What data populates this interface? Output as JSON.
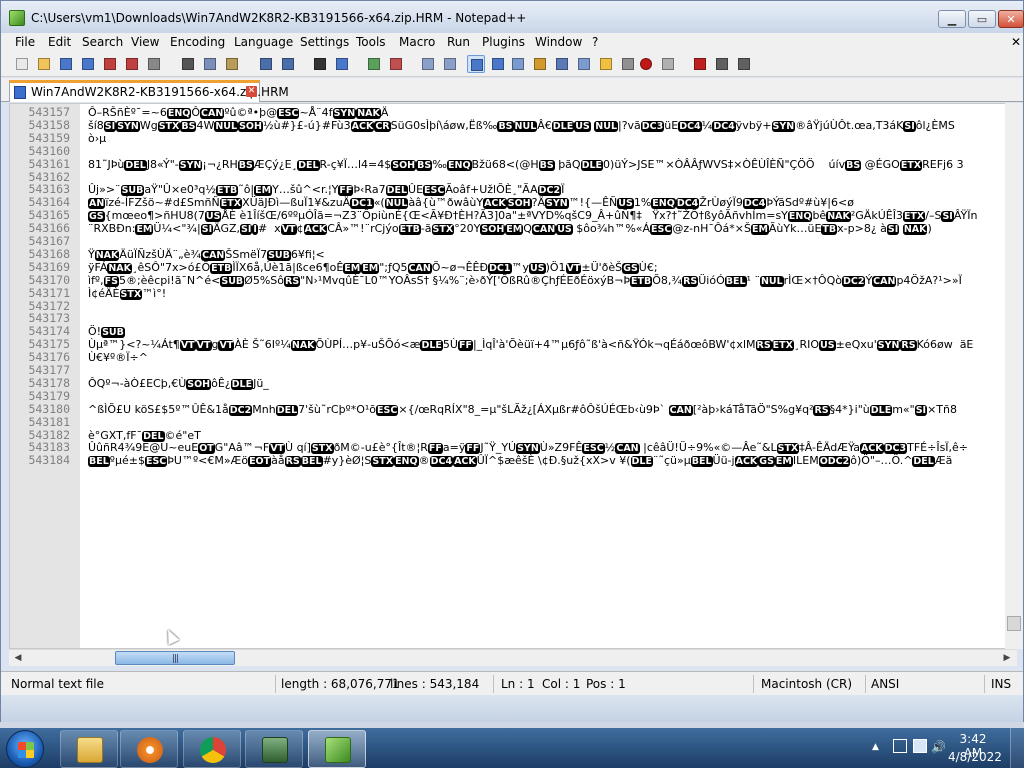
{
  "window": {
    "title": "C:\\Users\\vm1\\Downloads\\Win7AndW2K8R2-KB3191566-x64.zip.HRM - Notepad++",
    "min_glyph": "▁",
    "max_glyph": "▭",
    "close_glyph": "✕"
  },
  "menu": [
    "File",
    "Edit",
    "Search",
    "View",
    "Encoding",
    "Language",
    "Settings",
    "Tools",
    "Macro",
    "Run",
    "Plugins",
    "Window",
    "?"
  ],
  "menu_close": "✕",
  "toolbar_icons": [
    "new-file-icon",
    "open-file-icon",
    "save-icon",
    "save-all-icon",
    "close-icon",
    "close-all-icon",
    "print-icon",
    "cut-icon",
    "copy-icon",
    "paste-icon",
    "undo-icon",
    "redo-icon",
    "find-icon",
    "replace-icon",
    "zoom-in-icon",
    "zoom-out-icon",
    "sync-vertical-icon",
    "sync-horizontal-icon",
    "word-wrap-icon",
    "show-all-chars-icon",
    "indent-guide-icon",
    "user-defined-lang-icon",
    "doc-map-icon",
    "function-list-icon",
    "folder-workspace-icon",
    "monitor-icon",
    "record-macro-icon",
    "stop-record-icon",
    "play-macro-icon",
    "run-macro-multiple-icon",
    "save-macro-icon"
  ],
  "tab": {
    "label": "Win7AndW2K8R2-KB3191566-x64.zip.HRM",
    "close_glyph": "✕"
  },
  "editor": {
    "lines": [
      {
        "n": "543157",
        "t": "Ô–RŠñÈº¯=~6",
        "cc": [
          [
            "ENQ"
          ],
          "Ô",
          [
            "CAN"
          ],
          "ºû©ª•þ@",
          [
            "ESC"
          ],
          "~Å¨4f",
          [
            "SYN"
          ],
          [
            "NAK"
          ],
          "Ä"
        ]
      },
      {
        "n": "543158",
        "t": "ší8",
        "cc": [
          [
            "SI"
          ],
          [
            "SYN"
          ],
          "Wg",
          [
            "STX"
          ],
          [
            "BS"
          ],
          "4W",
          [
            "NUL"
          ],
          [
            "SOH"
          ],
          "½ù#}£-ú}#Fù3",
          [
            "ACK"
          ],
          [
            "CR"
          ],
          "SüG0sÌþí\\áøw,Ëß‰",
          [
            "BS"
          ],
          [
            "NUL"
          ],
          "Â€",
          [
            "DLE"
          ],
          [
            "US"
          ],
          " ",
          [
            "NUL"
          ],
          "|?vã",
          [
            "DC3"
          ],
          "üE",
          [
            "DC4"
          ],
          "¼",
          [
            "DC4"
          ],
          "ÿvbÿ+",
          [
            "SYN"
          ],
          "®âŸjúÙÔt.œa,T3áK",
          [
            "SI"
          ],
          "ôl¿ÈMS"
        ]
      },
      {
        "n": "543159",
        "t": "ò›µ",
        "cc": []
      },
      {
        "n": "543160",
        "t": "",
        "cc": []
      },
      {
        "n": "543161",
        "t": "81˜JÞù",
        "cc": [
          [
            "DEL"
          ],
          "J8«Ý\"-",
          [
            "SYN"
          ],
          "¡¬¿RH",
          [
            "BS"
          ],
          "ÆÇý¿E¸",
          [
            "DEL"
          ],
          "R-ç¥Ï…l4=4$",
          [
            "SOH"
          ],
          [
            "BS"
          ],
          "‰",
          [
            "ENQ"
          ],
          "Bžü68<(@H",
          [
            "BS"
          ],
          " þãQ",
          [
            "DLE"
          ],
          "0)üÝ>JSE™×ÒÂÂƒWVS‡×ÒÊÙÎÈÑ\"ÇÖÖ    úív",
          [
            "BS"
          ],
          " @ÉGO",
          [
            "ETX"
          ],
          "REFj6 3"
        ]
      },
      {
        "n": "543162",
        "t": "",
        "cc": []
      },
      {
        "n": "543163",
        "t": "Ûj»>¨",
        "cc": [
          [
            "SUB"
          ],
          "aŸ\"Û×e0³q½",
          [
            "ETB"
          ],
          "˜ô|",
          [
            "EM"
          ],
          "Y…šû^<r.¦Y",
          [
            "FF"
          ],
          "Þ‹Ra7",
          [
            "DEL"
          ],
          "ÛE",
          [
            "ESC"
          ],
          "Ãoâf+UžlÕÈ¸\"ÃA",
          [
            "DC2"
          ],
          "Ï"
        ]
      },
      {
        "n": "543164",
        "t": "",
        "cc": [
          [
            "AN"
          ],
          "ïzé-ÍFZšö~#d£SmñÑ",
          [
            "ETX"
          ],
          "XÜäJÐì—ßuÏ1¥&zuÄ",
          [
            "DC1"
          ],
          "«(",
          [
            "NUL"
          ],
          "àâ{ù™ðwâùY",
          [
            "ACK"
          ],
          [
            "SOH"
          ],
          "?Ä",
          [
            "SYN"
          ],
          "™!{—ÊÑ",
          [
            "US"
          ],
          "1%",
          [
            "ENQ"
          ],
          [
            "DC4"
          ],
          "ŽrÙøýÏ9",
          [
            "DC4"
          ],
          "ÞÝãSdº#ù¥|6<ø"
        ]
      },
      {
        "n": "543165",
        "t": "",
        "cc": [
          [
            "GS"
          ],
          "{mœeo¶>ñHU8(7",
          [
            "US"
          ],
          "ÅÈ è1ÎíšŒ/6ººµÓÎã=¬Z3¨ÕpiùnÉ{Œ<Ã¥Ð†ÈH?Ã3]0a\"±ªVYD%qšC9_Â+ûÑ¶‡   Ÿx?†˜ŽÕ†ßyôÃñvhÍm=sY",
          [
            "ENQ"
          ],
          "bê",
          [
            "NAK"
          ],
          "²GÄkÚÊÎ3",
          [
            "ETX"
          ],
          "/–S",
          [
            "SI"
          ],
          "ÂŸÏn"
        ]
      },
      {
        "n": "543166",
        "t": "¨RXBÐn:",
        "cc": [
          [
            "EM"
          ],
          "Ü¼<\"¾|",
          [
            "SI"
          ],
          "ÄGZ,",
          [
            "SI"
          ],
          [
            "I"
          ],
          "#  x",
          [
            "VT"
          ],
          "¢",
          [
            "ACK"
          ],
          "CÂ»™!¨rCjýo",
          [
            "ETB"
          ],
          "-ã",
          [
            "STX"
          ],
          "°20Y",
          [
            "SOH"
          ],
          [
            "EM"
          ],
          "Q",
          [
            "CAN"
          ],
          [
            "US"
          ],
          " $ôo¾h™%«Á",
          [
            "ESC"
          ],
          "@z-nH¯Ôá*×Š",
          [
            "EM"
          ],
          "ÃùYk…üE",
          [
            "TB"
          ],
          "x-p>8¿ à",
          [
            "SI"
          ],
          " ",
          [
            "NAK"
          ],
          ")"
        ]
      },
      {
        "n": "543167",
        "t": "",
        "cc": []
      },
      {
        "n": "543168",
        "t": "Ÿ",
        "cc": [
          [
            "NAK"
          ],
          "ÄüÏÑzšÙÄ¨„è¾",
          [
            "CAN"
          ],
          "ŠSmëÏ7",
          [
            "SUB"
          ],
          "6¥fi¦<"
        ]
      },
      {
        "n": "543169",
        "t": "ÿFÁ",
        "cc": [
          [
            "NAK"
          ],
          "¸êSÔ\"7x>ó£Õ",
          [
            "ETB"
          ],
          "ÌÏX6å,Úè1ã|ßce6¶oÊ",
          [
            "EM"
          ],
          [
            "EM"
          ],
          "\";ƒQ5",
          [
            "CAN"
          ],
          "Õ~ø¬ÊÊÐ",
          [
            "DC1"
          ],
          "™y",
          [
            "US"
          ],
          ")Ö1",
          [
            "VT"
          ],
          "±Ü'ðèŠ",
          [
            "GS"
          ],
          "Ù€;"
        ]
      },
      {
        "n": "543170",
        "t": "ìfº,",
        "cc": [
          [
            "FS"
          ],
          "5®;èêcpi!ã¯N^é<",
          [
            "SUB"
          ],
          "Ø5%Sô",
          [
            "RS"
          ],
          "\"N›¹MvqûÈ¯L0™YOÂsS† §¼%¨;è›ðÝ['ÕßRû®ÇhƒÉEðÉöxýB¬Þ",
          [
            "ETB"
          ],
          "Õ8,¾",
          [
            "RS"
          ],
          "ÜióÓ",
          [
            "BEL"
          ],
          "¹ ¨",
          [
            "NUL"
          ],
          "rÌŒ×†ÔQò",
          [
            "DC2"
          ],
          "Ý",
          [
            "CAN"
          ],
          "p4ÖžA?¹>»Ï"
        ]
      },
      {
        "n": "543171",
        "t": "Ì¢éÄÈ",
        "cc": [
          [
            "STX"
          ],
          "™ì°!"
        ]
      },
      {
        "n": "543172",
        "t": "",
        "cc": []
      },
      {
        "n": "543173",
        "t": "",
        "cc": []
      },
      {
        "n": "543174",
        "t": "Ö!",
        "cc": [
          [
            "SUB"
          ]
        ]
      },
      {
        "n": "543175",
        "t": "Ùµª™}<?~¼Át¶",
        "cc": [
          [
            "VT"
          ],
          [
            "VT"
          ],
          "g",
          [
            "VT"
          ],
          "ÀÈ Š˜6Iº¼",
          [
            "NAK"
          ],
          "ÕÙPÍ…p¥-uŠÕó<æ",
          [
            "DLE"
          ],
          "5Ù",
          [
            "FF"
          ],
          "|_ÌqÎ'à'Õèüï+4™µ6ƒô˜ß'à<ñ&ŸÓk¬qÉáðœôBW'¢xlM",
          [
            "RS"
          ],
          [
            "ETX"
          ],
          "¸RIO",
          [
            "US"
          ],
          "±eQxu'",
          [
            "SYN"
          ],
          [
            "RS"
          ],
          "Kó6øw  äE"
        ]
      },
      {
        "n": "543176",
        "t": "Ù€¥º®Ï÷^",
        "cc": []
      },
      {
        "n": "543177",
        "t": "",
        "cc": []
      },
      {
        "n": "543178",
        "t": "ÔQº¬-àÒ£ECþ,€Ù",
        "cc": [
          [
            "SOH"
          ],
          "ôÊ¿",
          [
            "DLE"
          ],
          "Jü_"
        ]
      },
      {
        "n": "543179",
        "t": "",
        "cc": []
      },
      {
        "n": "543180",
        "t": "^ßÌÕ£U köS£$5º™ÛÊ&1å",
        "cc": [
          [
            "DC2"
          ],
          "Mnh",
          [
            "DEL"
          ],
          "7'šù˜rCþº*O¹õ",
          [
            "ESC"
          ],
          "×{/œRqRÍX\"8_=µ\"šLÃž¿[ÁXµßr#ôÔšÚÉŒb‹ù9Þ` ",
          [
            "CAN"
          ],
          "[²àþ›káTåTãÖ\"S%g¥q²",
          [
            "RS"
          ],
          "§4*}i\"ù",
          [
            "DLE"
          ],
          "m«\"",
          [
            "SI"
          ],
          "×Tñ8"
        ]
      },
      {
        "n": "543181",
        "t": "",
        "cc": []
      },
      {
        "n": "543182",
        "t": "è°GXT,fF¯",
        "cc": [
          [
            "DEL"
          ],
          "©é\"eT"
        ]
      },
      {
        "n": "543183",
        "t": "ÛûñR4¾9E@U~euE",
        "cc": [
          [
            "OT"
          ],
          "G\"Aâ™¬F",
          [
            "VT"
          ],
          "Ù qí]",
          [
            "STX"
          ],
          "ðM©-u£è°{Ît®¦R",
          [
            "FF"
          ],
          "a=ÿ",
          [
            "FF"
          ],
          "J˜Ÿ_YÚ",
          [
            "SYN"
          ],
          "Ù»Z9FÊ",
          [
            "ESC"
          ],
          "½",
          [
            "CAN"
          ],
          " |cêâÜ!Ü÷9%«©—Âe˜&L",
          [
            "STX"
          ],
          "‡Â-ÊÄdÆŸa",
          [
            "ACK"
          ],
          [
            "DC3"
          ],
          "TFÉ÷ÎsÏ,ê÷"
        ]
      },
      {
        "n": "543184",
        "t": "",
        "cc": [
          [
            "BEL"
          ],
          "ºµé±$",
          [
            "ESC"
          ],
          "ÞU™º<€M»Æö",
          [
            "EOT"
          ],
          "àå",
          [
            "RS"
          ],
          [
            "BEL"
          ],
          "#y}èØ¦S",
          [
            "STX"
          ],
          [
            "ENQ"
          ],
          "®",
          [
            "DC4"
          ],
          [
            "ACK"
          ],
          "ÛÏ^$æêšÈ \\¢Ð.§už{xX>v ¥(",
          [
            "DLE"
          ],
          "¨˜çü»µ",
          [
            "BEL"
          ],
          "Üü-j",
          [
            "ACK"
          ],
          [
            "GS"
          ],
          [
            "EM"
          ],
          "ILEM",
          [
            "ÔDC2"
          ],
          "ô)Ö\"–…Ö.^",
          [
            "DEL"
          ],
          "Æä"
        ]
      }
    ]
  },
  "hscroll": {
    "left_arrow": "◀",
    "right_arrow": "▶",
    "grip": "|||"
  },
  "status": {
    "mode": "Normal text file",
    "length": "length : 68,076,771",
    "lines": "lines : 543,184",
    "ln": "Ln : 1",
    "col": "Col : 1",
    "pos": "Pos : 1",
    "eol": "Macintosh (CR)",
    "encoding": "ANSI",
    "ins": "INS"
  },
  "taskbar": {
    "buttons": [
      "explorer-icon",
      "media-player-icon",
      "chrome-icon",
      "system-monitor-icon",
      "notepadpp-icon"
    ],
    "tray_arrow": "▲",
    "volume_glyph": "🔊",
    "time": "3:42 AM",
    "date": "4/8/2022"
  },
  "colors": {
    "accent": "#f0a030",
    "control_char_bg": "#000000",
    "gutter_bg": "#e4e4e4"
  }
}
